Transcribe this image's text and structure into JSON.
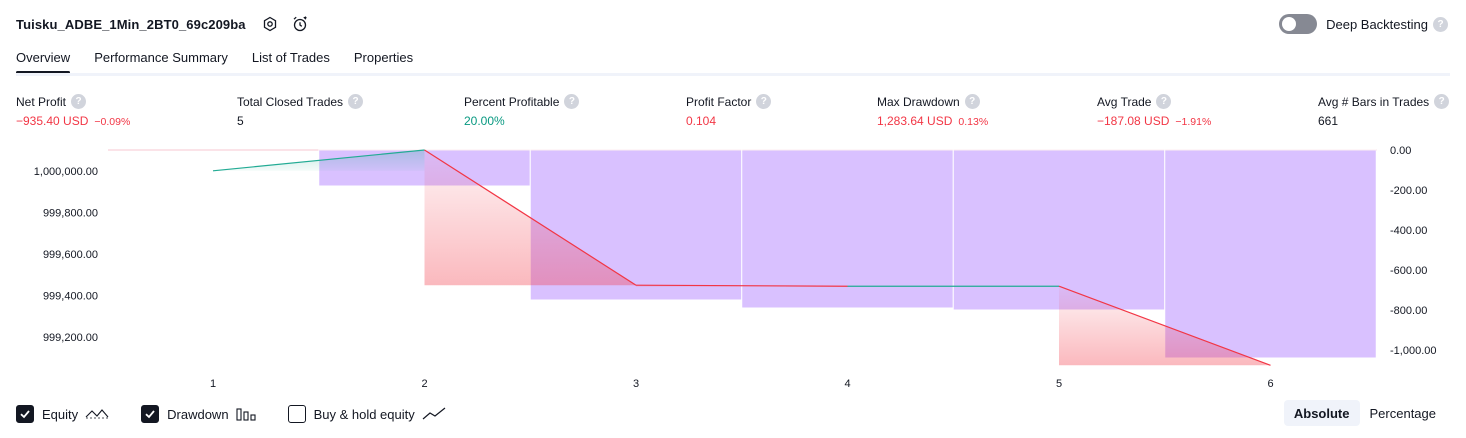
{
  "header": {
    "strategy_name": "Tuisku_ADBE_1Min_2BT0_69c209ba",
    "deep_backtesting_label": "Deep Backtesting",
    "deep_backtesting_enabled": false
  },
  "tabs": [
    {
      "label": "Overview",
      "active": true
    },
    {
      "label": "Performance Summary",
      "active": false
    },
    {
      "label": "List of Trades",
      "active": false
    },
    {
      "label": "Properties",
      "active": false
    }
  ],
  "metrics": {
    "net_profit": {
      "label": "Net Profit",
      "value": "−935.40 USD",
      "sub": "−0.09%"
    },
    "total_closed_trades": {
      "label": "Total Closed Trades",
      "value": "5"
    },
    "percent_profitable": {
      "label": "Percent Profitable",
      "value": "20.00%"
    },
    "profit_factor": {
      "label": "Profit Factor",
      "value": "0.104"
    },
    "max_drawdown": {
      "label": "Max Drawdown",
      "value": "1,283.64 USD",
      "sub": "0.13%"
    },
    "avg_trade": {
      "label": "Avg Trade",
      "value": "−187.08 USD",
      "sub": "−1.91%"
    },
    "avg_bars": {
      "label": "Avg # Bars in Trades",
      "value": "661"
    }
  },
  "chart_data": {
    "type": "line",
    "x": [
      1,
      2,
      3,
      4,
      5,
      6
    ],
    "x_tick_labels": [
      "1",
      "2",
      "3",
      "4",
      "5",
      "6"
    ],
    "series": [
      {
        "values": [
          1000000.0,
          1000100.0,
          999450.0,
          999445.0,
          999445.0,
          999065.0
        ]
      },
      {
        "values": [
          0,
          -180,
          -750,
          -790,
          -800,
          -1040
        ]
      }
    ],
    "left_axis": {
      "tick_labels": [
        "1,000,000.00",
        "999,800.00",
        "999,600.00",
        "999,400.00",
        "999,200.00"
      ],
      "ylim": [
        999100,
        1000100
      ]
    },
    "right_axis": {
      "tick_labels": [
        "0.00",
        "-200.00",
        "-400.00",
        "-600.00",
        "-800.00",
        "-1,000.00"
      ],
      "ylim": [
        -1040,
        0
      ]
    },
    "colors": {
      "equity_up": "#22ab94",
      "equity_down": "#f23645",
      "drawdown": "#c9a7ff"
    }
  },
  "legend": {
    "equity": {
      "label": "Equity",
      "checked": true
    },
    "drawdown": {
      "label": "Drawdown",
      "checked": true
    },
    "buy_hold": {
      "label": "Buy & hold equity",
      "checked": false
    }
  },
  "scale_switch": {
    "absolute": "Absolute",
    "percentage": "Percentage",
    "active": "absolute"
  }
}
